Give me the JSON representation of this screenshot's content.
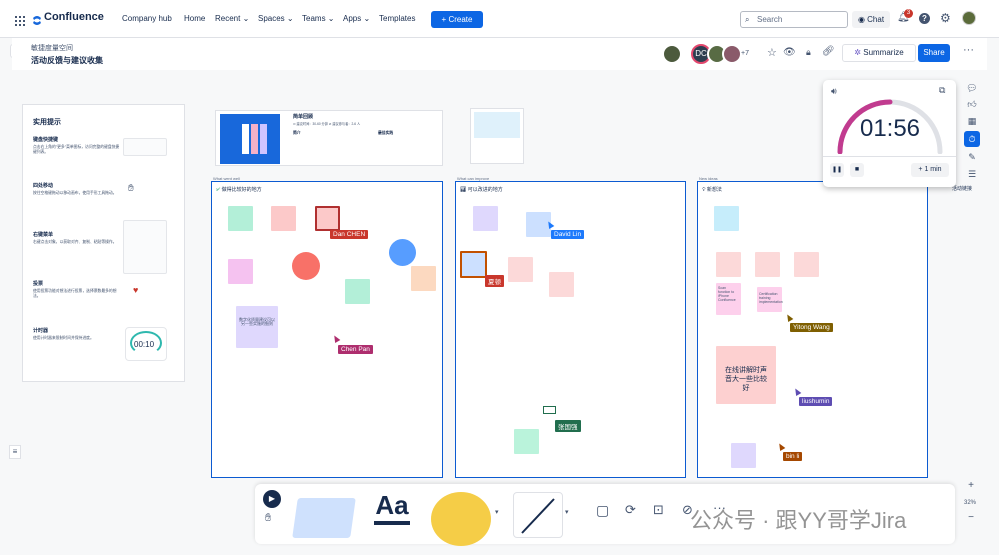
{
  "nav": {
    "product": "Confluence",
    "items": [
      "Company hub",
      "Home",
      "Recent",
      "Spaces",
      "Teams",
      "Apps",
      "Templates"
    ],
    "create": "+ Create",
    "search_placeholder": "Search",
    "chat": "Chat",
    "notif_count": "3"
  },
  "page": {
    "space": "敏捷度量空间",
    "title": "活动反馈与建议收集",
    "avatar_dc": "DC",
    "avatar_more": "+7",
    "summarize": "Summarize",
    "share": "Share"
  },
  "tips": {
    "title": "实用提示",
    "items": [
      {
        "t": "键盘快捷键",
        "d": "点击右上角的\"更多\"菜单图标，访问完整的键盘快捷键列表。"
      },
      {
        "t": "四处移动",
        "d": "按住空格键拖动以移动画布，使用手形工具拖动。"
      },
      {
        "t": "右键菜单",
        "d": "右键点击对象，以获取对齐、复制、粘贴等操作。"
      },
      {
        "t": "投票",
        "d": "使用投票功能对想法进行投票，选择票数最多的想法。"
      },
      {
        "t": "计时器",
        "d": "使用计时器来限制时间并保持进度。"
      }
    ],
    "timer_text": "00:10"
  },
  "template_card": {
    "title": "简单回顾",
    "meta": "⊙ 建议时间：30-60 分钟   ⊘ 建议参与者：2-6 人",
    "col1_title": "简介",
    "col2_title": "最佳实践"
  },
  "frames": [
    {
      "title": "做得比较好的地方",
      "small": "What went well"
    },
    {
      "title": "可以改进的地方",
      "small": "What can improve"
    },
    {
      "title": "新想法",
      "small": "New ideas"
    }
  ],
  "cursors": [
    "Dan CHEN",
    "Chen Pan",
    "David Lin",
    "夏顿",
    "Yitong Wang",
    "liushumin",
    "张国强",
    "bin li"
  ],
  "notes": {
    "big": "在线讲解时声音大一些比较好",
    "purple": "数字化质量建议可以另一些实施的细则",
    "n1": "Scan function to iPhone Confluence",
    "n2": "Certification training implementation"
  },
  "timer": {
    "time": "01:56",
    "add": "+ 1 min"
  },
  "zoom": "32%",
  "side_label": "活动链接",
  "watermark": "公众号 · 跟YY哥学Jira",
  "bottom": {
    "text_tool": "Aa"
  },
  "colors": {
    "accent": "#0c66e4",
    "frame": "#0c5bd1",
    "timer_arc": "#c13b8f"
  }
}
